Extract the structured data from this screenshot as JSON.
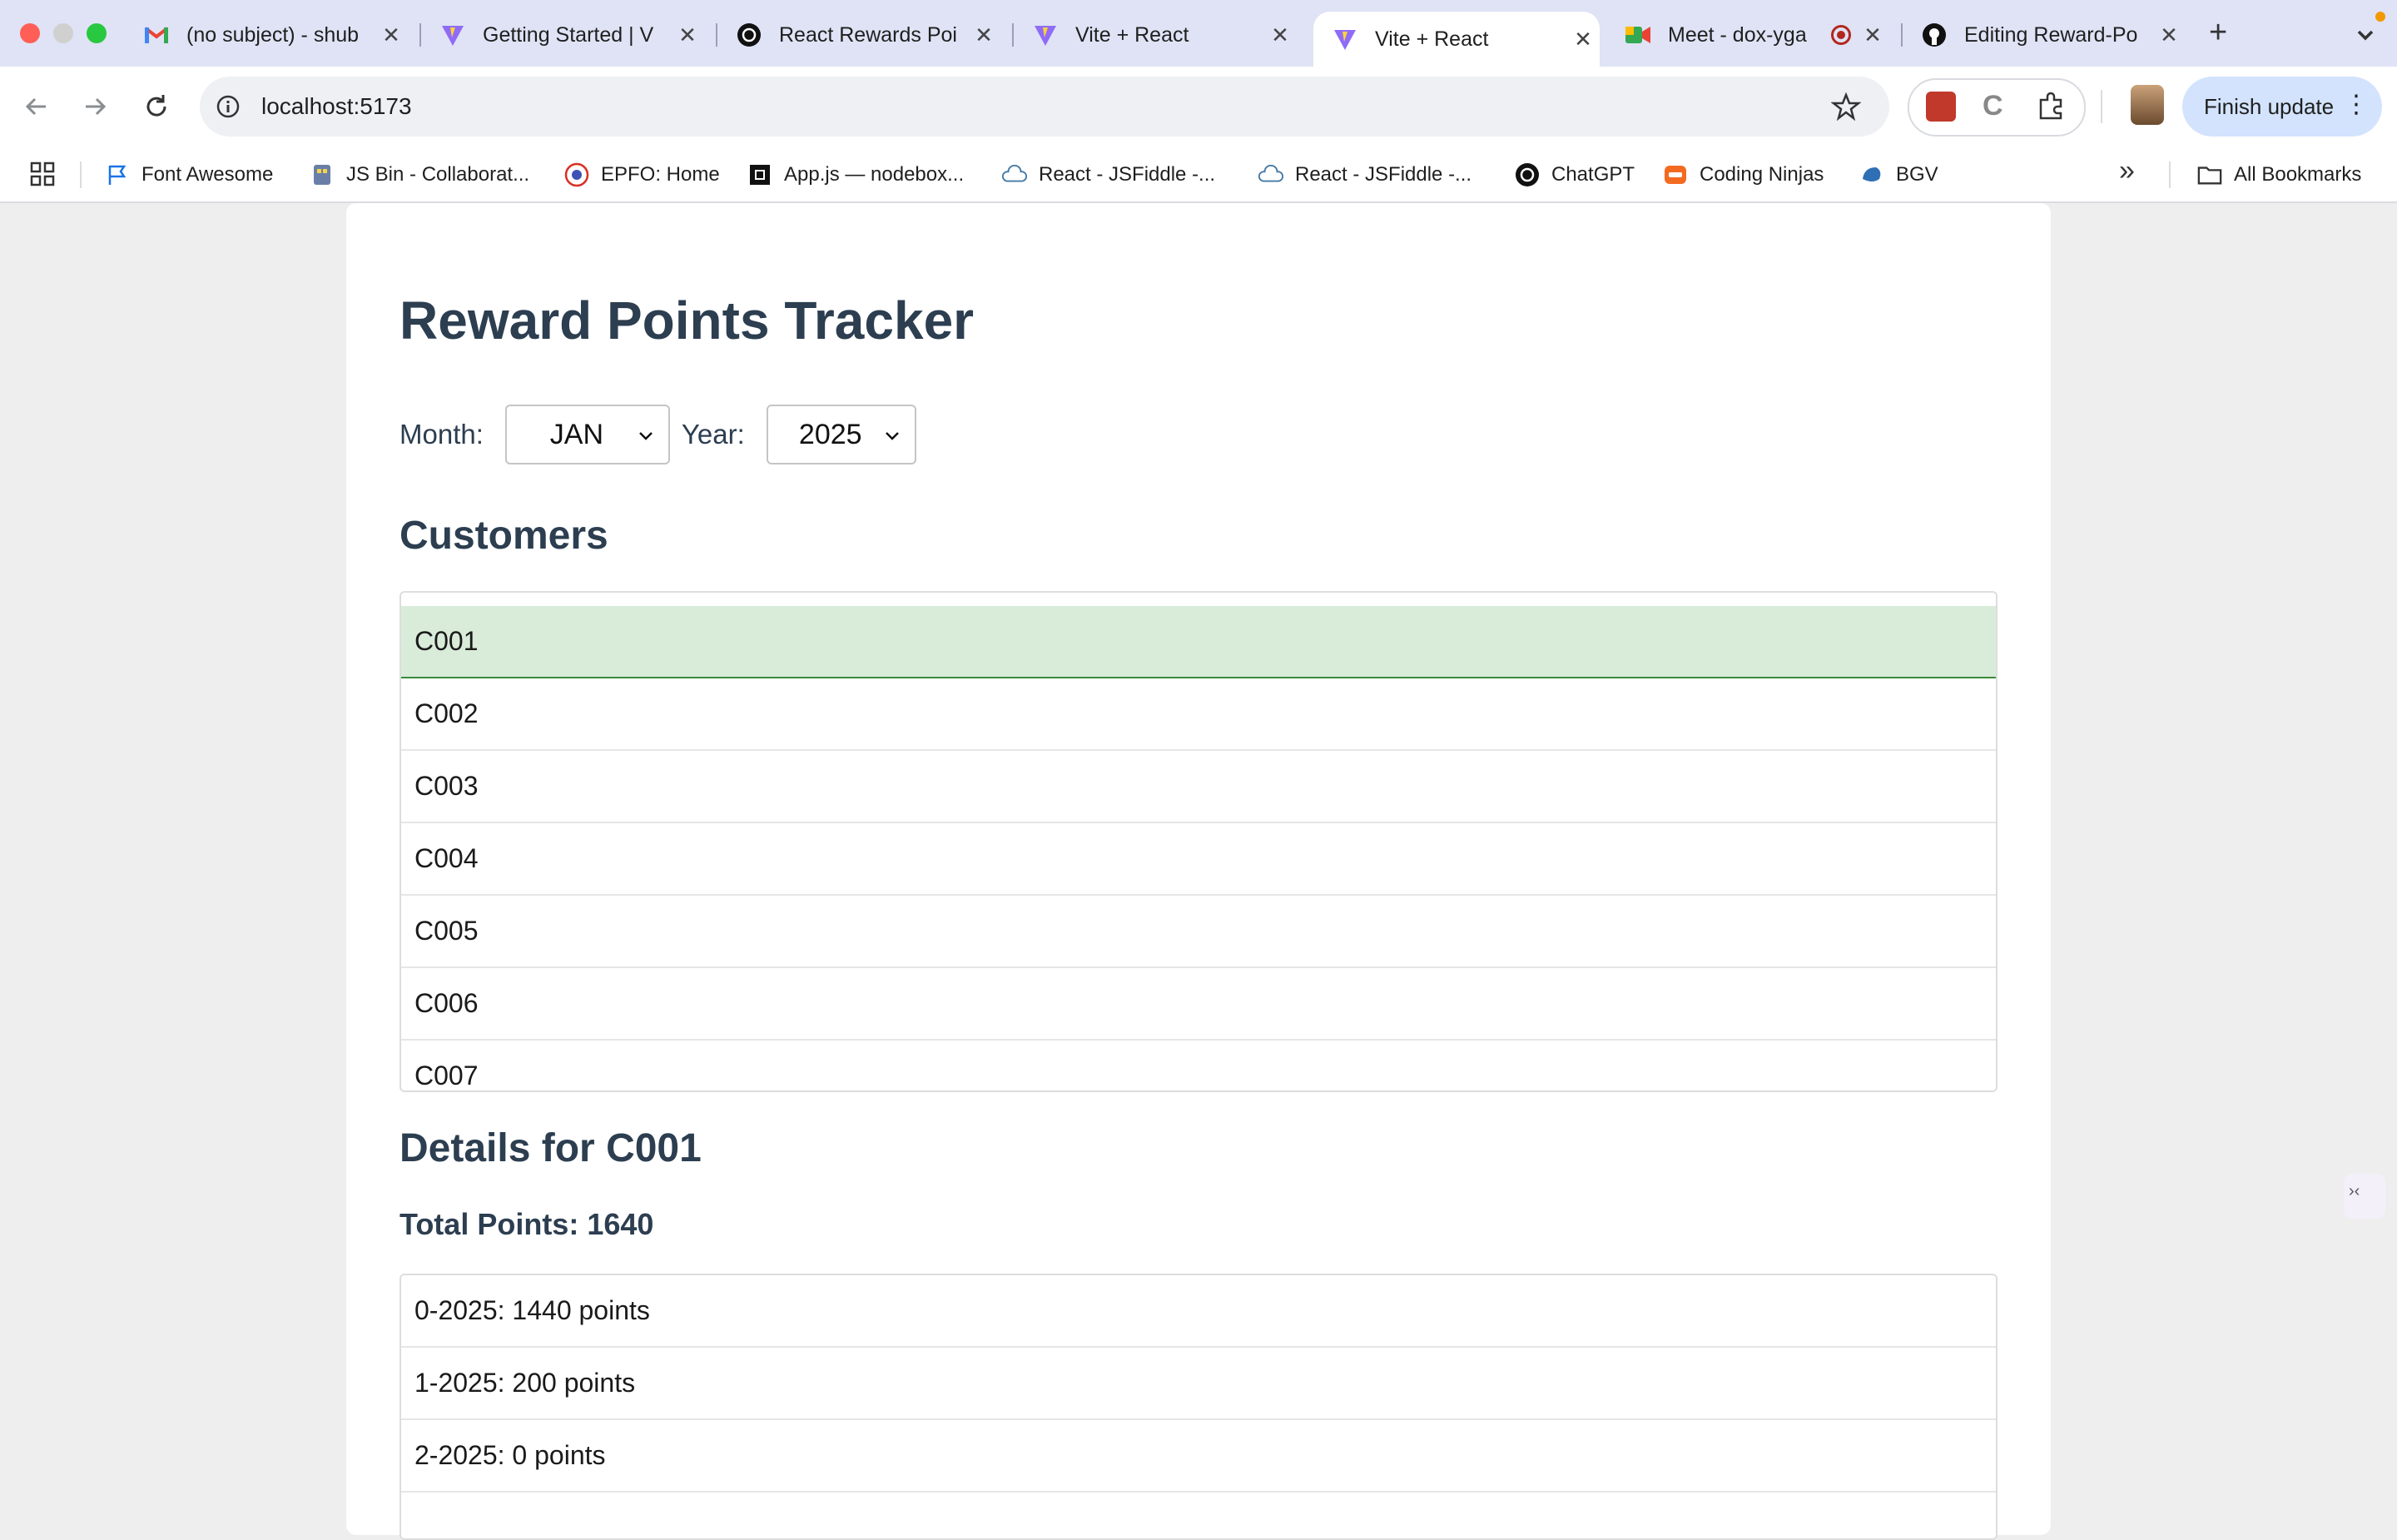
{
  "browser": {
    "tabs": [
      {
        "title": "(no subject) - shub",
        "icon": "gmail-icon"
      },
      {
        "title": "Getting Started | V",
        "icon": "vite-icon"
      },
      {
        "title": "React Rewards Poi",
        "icon": "chatgpt-icon"
      },
      {
        "title": "Vite + React",
        "icon": "vite-icon"
      },
      {
        "title": "Vite + React",
        "icon": "vite-icon",
        "active": true
      },
      {
        "title": "Meet - dox-yga",
        "icon": "meet-icon"
      },
      {
        "title": "Editing Reward-Po",
        "icon": "github-icon"
      }
    ],
    "url": "localhost:5173",
    "finish_update": "Finish update",
    "bookmarks": [
      {
        "label": "Font Awesome",
        "icon": "flag-icon"
      },
      {
        "label": "JS Bin - Collaborat...",
        "icon": "jsbin-icon"
      },
      {
        "label": "EPFO: Home",
        "icon": "epfo-icon"
      },
      {
        "label": "App.js — nodebox...",
        "icon": "codesandbox-icon"
      },
      {
        "label": "React - JSFiddle -...",
        "icon": "jsfiddle-icon"
      },
      {
        "label": "React - JSFiddle -...",
        "icon": "jsfiddle-icon"
      },
      {
        "label": "ChatGPT",
        "icon": "chatgpt-icon"
      },
      {
        "label": "Coding Ninjas",
        "icon": "codingninjas-icon"
      },
      {
        "label": "BGV",
        "icon": "bgv-icon"
      }
    ],
    "all_bookmarks": "All Bookmarks"
  },
  "app": {
    "title": "Reward Points Tracker",
    "month_label": "Month:",
    "month_value": "JAN",
    "year_label": "Year:",
    "year_value": "2025",
    "customers_heading": "Customers",
    "customers": [
      "C001",
      "C002",
      "C003",
      "C004",
      "C005",
      "C006",
      "C007"
    ],
    "selected_customer": "C001",
    "details_heading": "Details for C001",
    "total_points": "Total Points: 1640",
    "monthly": [
      "0-2025: 1440 points",
      "1-2025: 200 points",
      "2-2025: 0 points"
    ]
  }
}
